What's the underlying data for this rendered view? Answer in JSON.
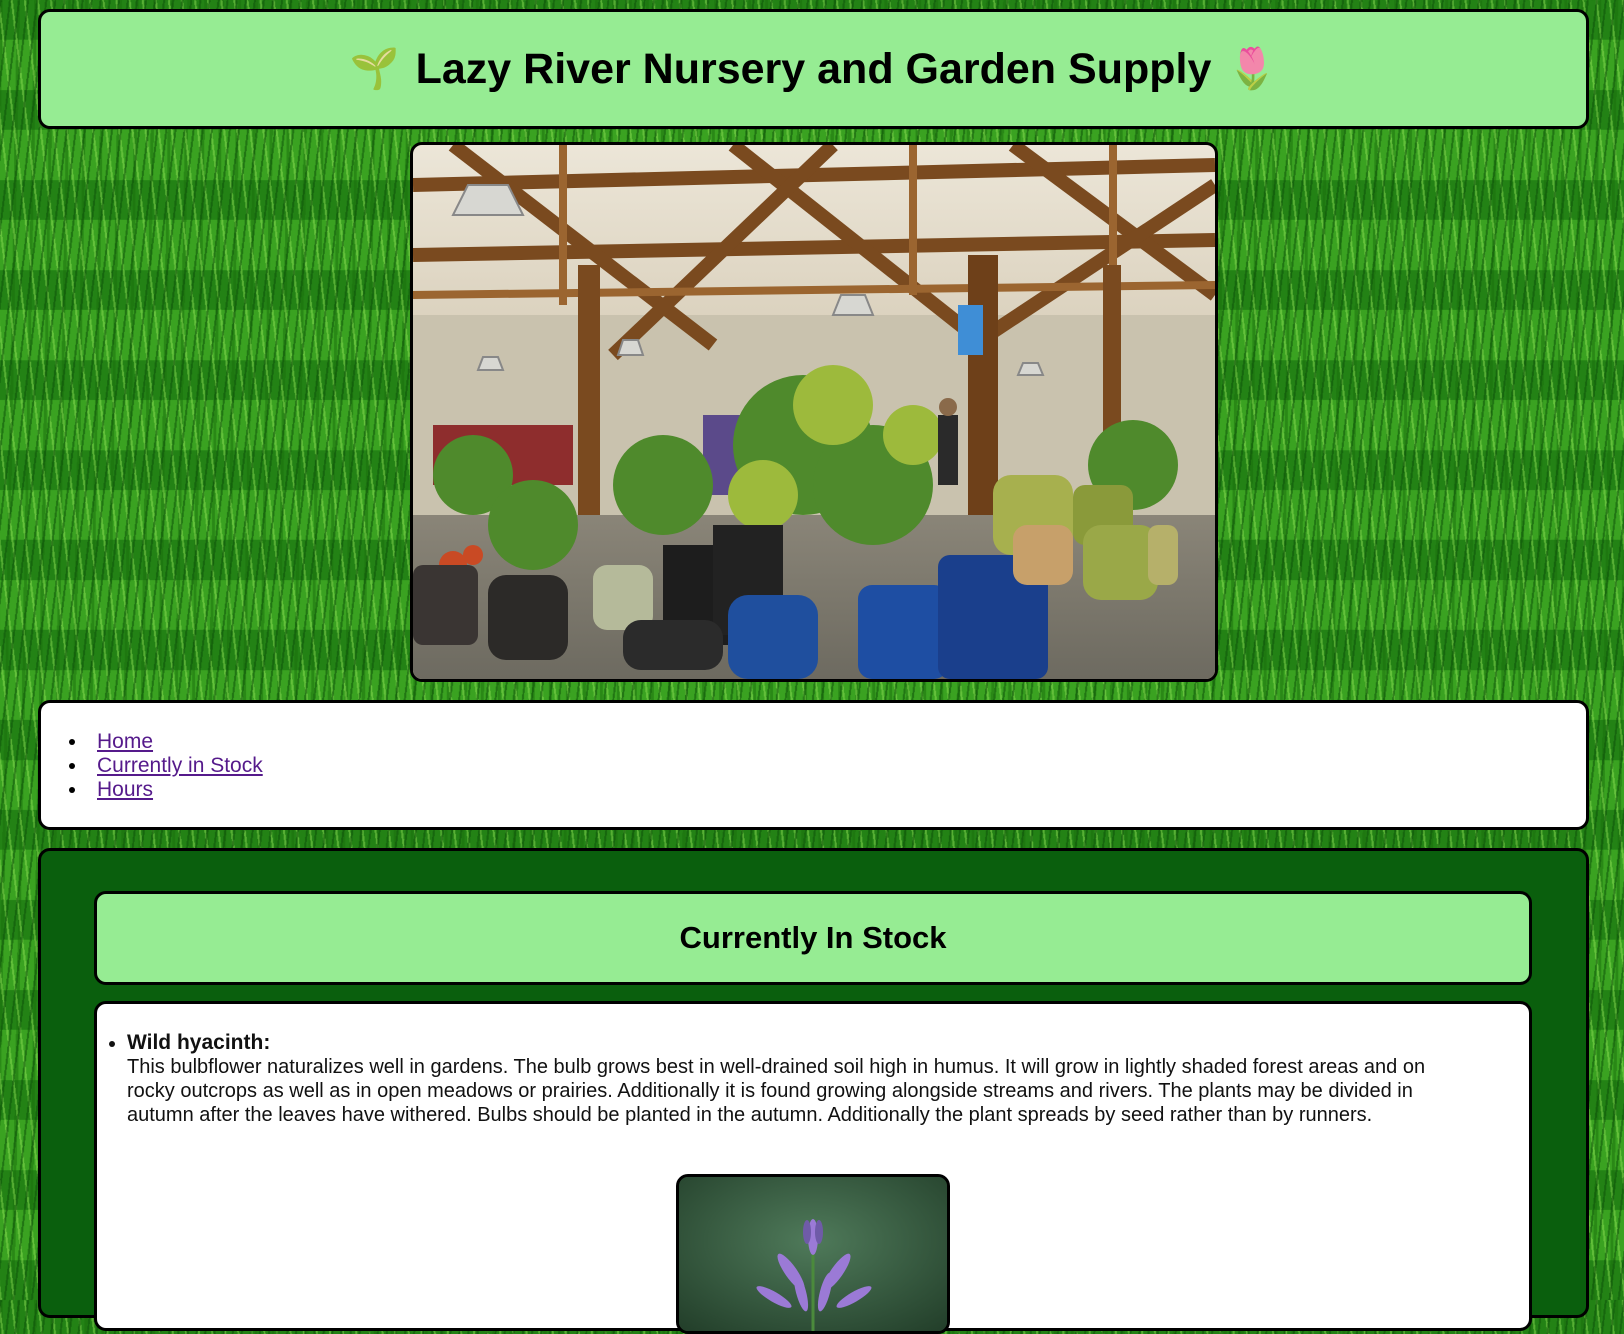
{
  "site": {
    "title": "Lazy River Nursery and Garden Supply",
    "title_left_icon": "seedling-icon",
    "title_right_icon": "tulip-icon",
    "left_emoji": "🌱",
    "right_emoji": "🌷"
  },
  "hero": {
    "image": "garden-center-interior-photo"
  },
  "nav": {
    "items": [
      {
        "label": "Home"
      },
      {
        "label": "Currently in Stock"
      },
      {
        "label": "Hours"
      }
    ]
  },
  "main": {
    "heading": "Currently In Stock",
    "items": [
      {
        "name": "Wild hyacinth:",
        "description": "This bulbflower naturalizes well in gardens. The bulb grows best in well-drained soil high in humus. It will grow in lightly shaded forest areas and on rocky outcrops as well as in open meadows or prairies. Additionally it is found growing alongside streams and rivers. The plants may be divided in autumn after the leaves have withered. Bulbs should be planted in the autumn. Additionally the plant spreads by seed rather than by runners.",
        "image": "wild-hyacinth-photo"
      }
    ]
  },
  "colors": {
    "header_bg": "#96ec93",
    "content_bg": "#0a5f0d",
    "nav_bg": "#ffffff",
    "link": "#551a8b",
    "border": "#000000"
  }
}
